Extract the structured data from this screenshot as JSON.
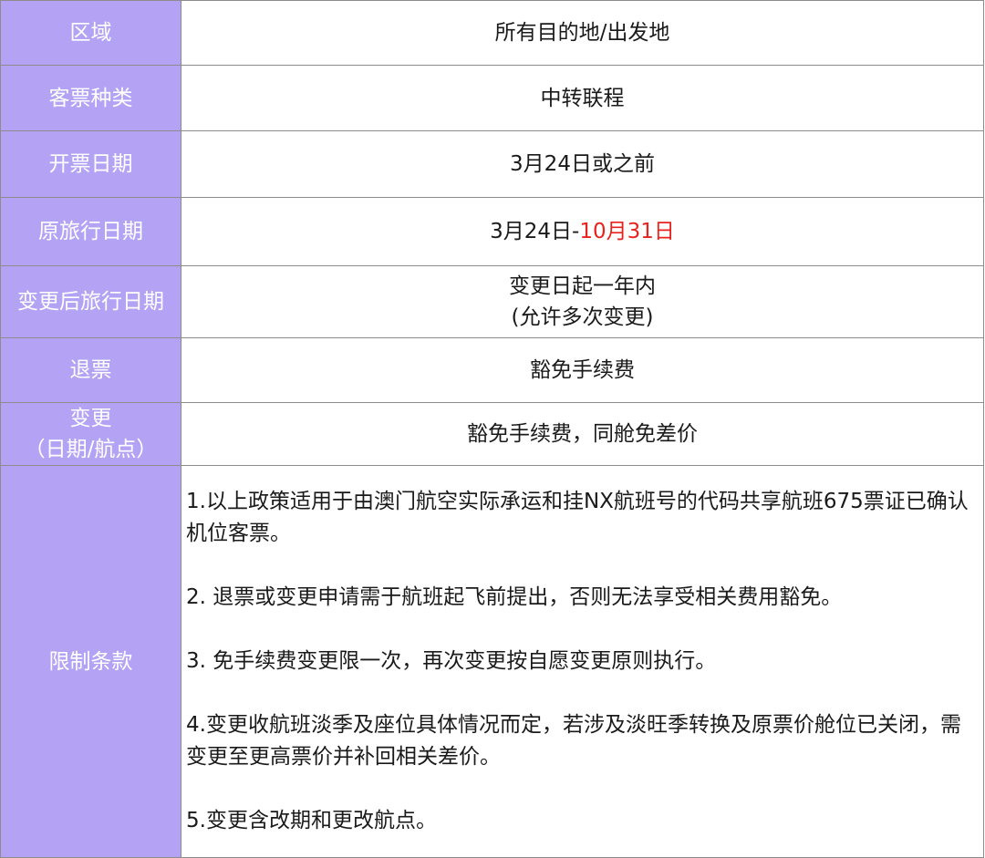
{
  "rows": [
    {
      "label": "区域",
      "value": "所有目的地/出发地"
    },
    {
      "label": "客票种类",
      "value": "中转联程"
    },
    {
      "label": "开票日期",
      "value": "3月24日或之前"
    },
    {
      "label": "原旅行日期",
      "value_part1": "3月24日-",
      "value_part2_red": "10月31日"
    },
    {
      "label": "变更后旅行日期",
      "value_line1": "变更日起一年内",
      "value_line2": "(允许多次变更)"
    },
    {
      "label": "退票",
      "value": "豁免手续费"
    },
    {
      "label_line1": "变更",
      "label_line2": "（日期/航点）",
      "value": "豁免手续费，同舱免差价"
    },
    {
      "label": "限制条款",
      "terms": [
        "1.以上政策适用于由澳门航空实际承运和挂NX航班号的代码共享航班675票证已确认机位客票。",
        "2. 退票或变更申请需于航班起飞前提出，否则无法享受相关费用豁免。",
        "3. 免手续费变更限一次，再次变更按自愿变更原则执行。",
        "4.变更收航班淡季及座位具体情况而定，若涉及淡旺季转换及原票价舱位已关闭，需变更至更高票价并补回相关差价。",
        "5.变更含改期和更改航点。"
      ]
    }
  ],
  "colors": {
    "label_bg": "#b4a3f5",
    "label_text": "#ffffff",
    "highlight": "#e8231f",
    "border": "#8c8c8c"
  }
}
